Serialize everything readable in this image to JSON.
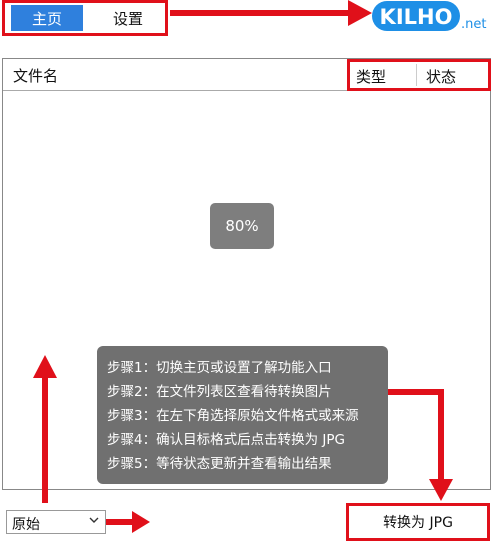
{
  "tabs": {
    "home": "主页",
    "settings": "设置"
  },
  "logo": {
    "brand": "KILHO",
    "suffix": ".net"
  },
  "file_list": {
    "col_name": "文件名",
    "col_type": "类型",
    "col_status": "状态",
    "progress": "80%"
  },
  "instructions": [
    "步骤1：切换主页或设置了解功能入口",
    "步骤2：在文件列表区查看待转换图片",
    "步骤3：在左下角选择原始文件格式或来源",
    "步骤4：确认目标格式后点击转换为 JPG",
    "步骤5：等待状态更新并查看输出结果"
  ],
  "source_select": {
    "value": "原始"
  },
  "convert_button": {
    "label": "转换为 JPG"
  },
  "colors": {
    "highlight": "#e0101a",
    "accent": "#2f80dd",
    "logo_blue": "#1e8fe6"
  }
}
